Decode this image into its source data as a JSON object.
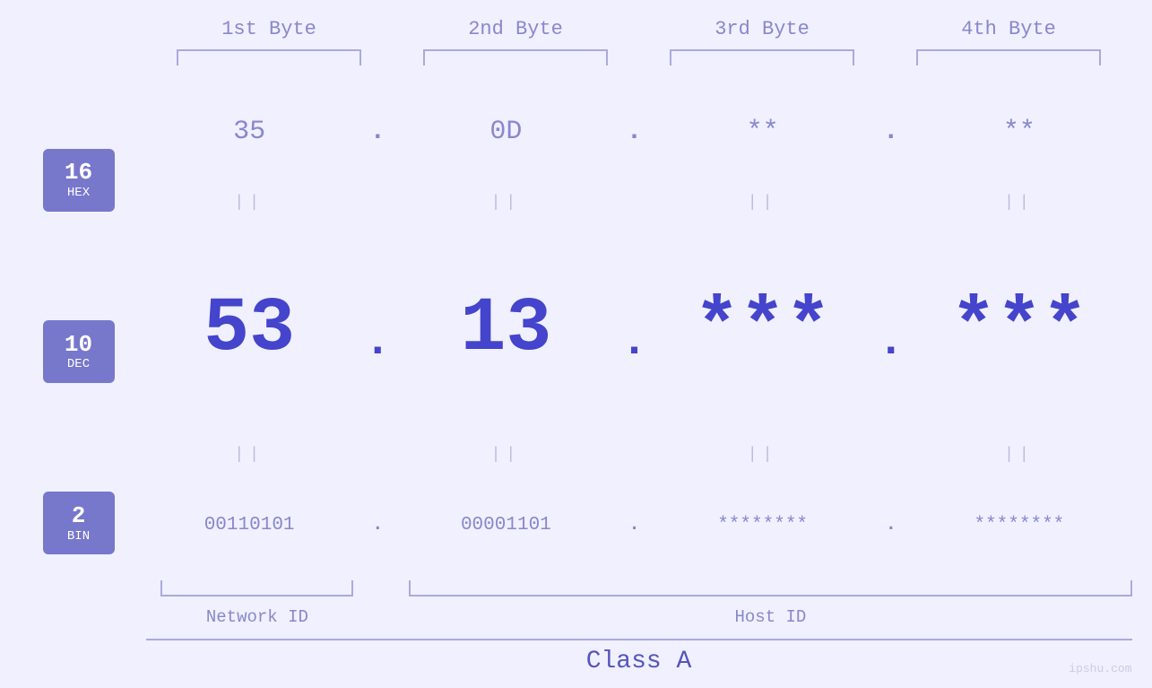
{
  "headers": {
    "byte1": "1st Byte",
    "byte2": "2nd Byte",
    "byte3": "3rd Byte",
    "byte4": "4th Byte"
  },
  "bases": {
    "hex": {
      "number": "16",
      "label": "HEX"
    },
    "dec": {
      "number": "10",
      "label": "DEC"
    },
    "bin": {
      "number": "2",
      "label": "BIN"
    }
  },
  "rows": {
    "hex": {
      "b1": "35",
      "b2": "0D",
      "b3": "**",
      "b4": "**"
    },
    "dec": {
      "b1": "53",
      "b2": "13",
      "b3": "***",
      "b4": "***"
    },
    "bin": {
      "b1": "00110101",
      "b2": "00001101",
      "b3": "********",
      "b4": "********"
    }
  },
  "labels": {
    "network_id": "Network ID",
    "host_id": "Host ID",
    "class": "Class A"
  },
  "watermark": "ipshu.com",
  "dots": {
    "dot": ".",
    "equals": "||"
  }
}
